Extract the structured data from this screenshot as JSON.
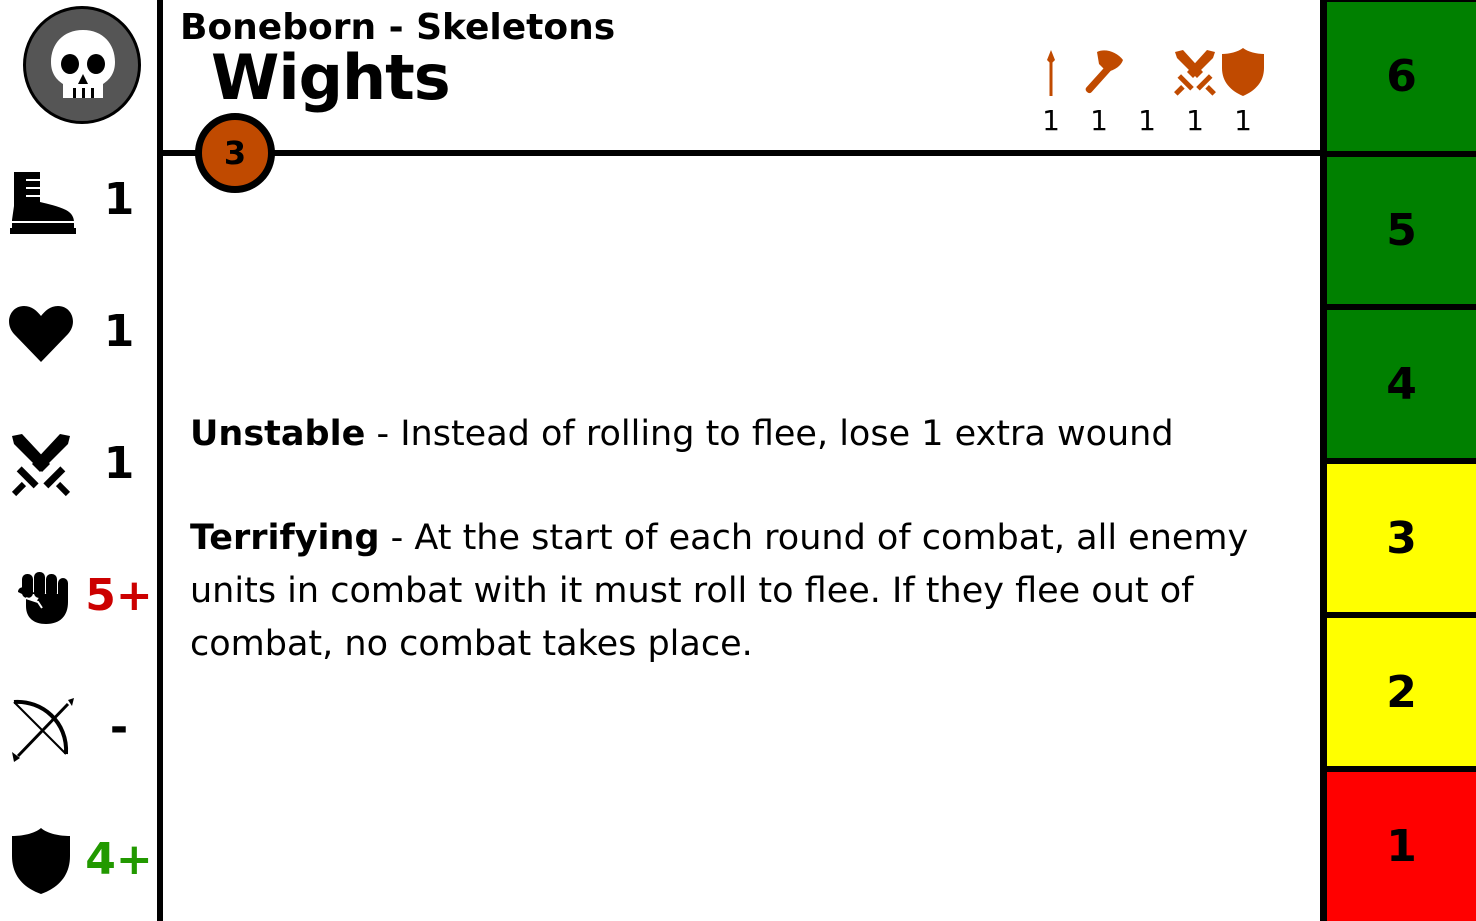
{
  "header": {
    "faction": "Boneborn - Skeletons",
    "unit_name": "Wights",
    "points": "3"
  },
  "keywords": [
    {
      "icon": "spear-icon",
      "value": "1"
    },
    {
      "icon": "axe-icon",
      "value": "1"
    },
    {
      "icon": "sword-icon",
      "value": "1"
    },
    {
      "icon": "crossed-swords-icon",
      "value": "1"
    },
    {
      "icon": "shield-icon",
      "value": "1"
    }
  ],
  "stats": [
    {
      "icon": "boot-icon",
      "label": "movement",
      "value": "1",
      "color": "#000000"
    },
    {
      "icon": "heart-icon",
      "label": "health",
      "value": "1",
      "color": "#000000"
    },
    {
      "icon": "crossed-swords-icon",
      "label": "attacks",
      "value": "1",
      "color": "#000000"
    },
    {
      "icon": "fist-icon",
      "label": "melee",
      "value": "5+",
      "color": "#cc0000"
    },
    {
      "icon": "bow-icon",
      "label": "ranged",
      "value": "-",
      "color": "#000000"
    },
    {
      "icon": "shield-icon",
      "label": "save",
      "value": "4+",
      "color": "#229900"
    }
  ],
  "abilities": [
    {
      "name": "Unstable",
      "separator": " - ",
      "text": "Instead of rolling to flee, lose 1 extra wound"
    },
    {
      "name": "Terrifying",
      "separator": " - ",
      "text": "At the start of each round of combat, all enemy units in combat with it must roll to flee. If they flee out of combat, no combat takes place."
    }
  ],
  "wound_track": [
    {
      "value": "6",
      "color": "#008000"
    },
    {
      "value": "5",
      "color": "#008000"
    },
    {
      "value": "4",
      "color": "#008000"
    },
    {
      "value": "3",
      "color": "#ffff00"
    },
    {
      "value": "2",
      "color": "#ffff00"
    },
    {
      "value": "1",
      "color": "#ff0000"
    }
  ],
  "colors": {
    "accent": "#c04a00",
    "faction_logo_bg": "#555555"
  }
}
